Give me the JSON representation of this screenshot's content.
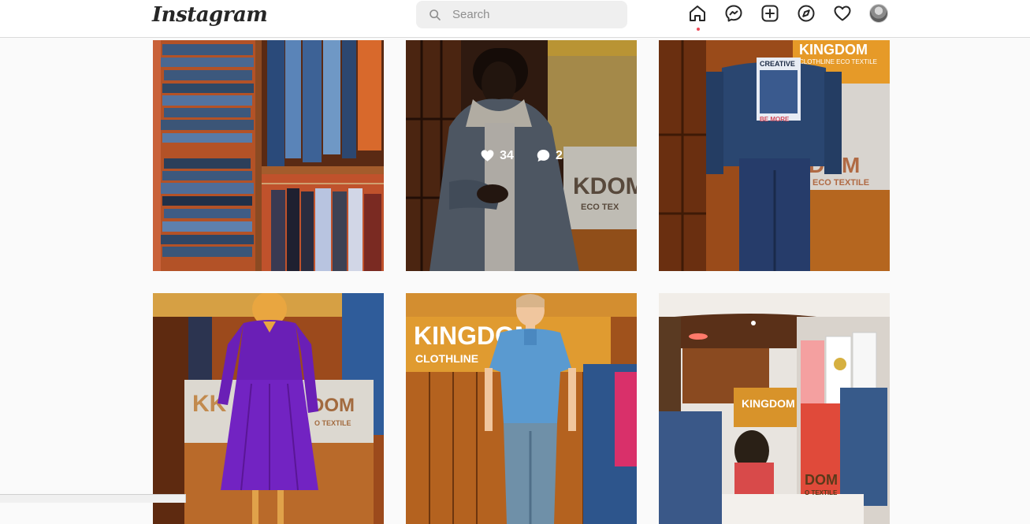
{
  "header": {
    "logo_text": "Instagram",
    "search_placeholder": "Search",
    "nav_icons": [
      "home-icon",
      "messenger-icon",
      "new-post-icon",
      "explore-icon",
      "activity-heart-icon",
      "profile-avatar"
    ]
  },
  "posts": [
    {
      "id": "post-1",
      "subject": "denim jeans shelves and shirts rack"
    },
    {
      "id": "post-2",
      "subject": "man in denim sherpa jacket",
      "likes": "34",
      "comments": "2"
    },
    {
      "id": "post-3",
      "subject": "mannequin in denim jacket, back view"
    },
    {
      "id": "post-4",
      "subject": "mannequin in purple dress"
    },
    {
      "id": "post-5",
      "subject": "child mannequin in blue polo shirt"
    },
    {
      "id": "post-6",
      "subject": "boutique store interior with shoppers"
    }
  ],
  "colors": {
    "accent_dot": "#ed4956",
    "header_bg": "#ffffff",
    "page_bg": "#fafafa"
  }
}
